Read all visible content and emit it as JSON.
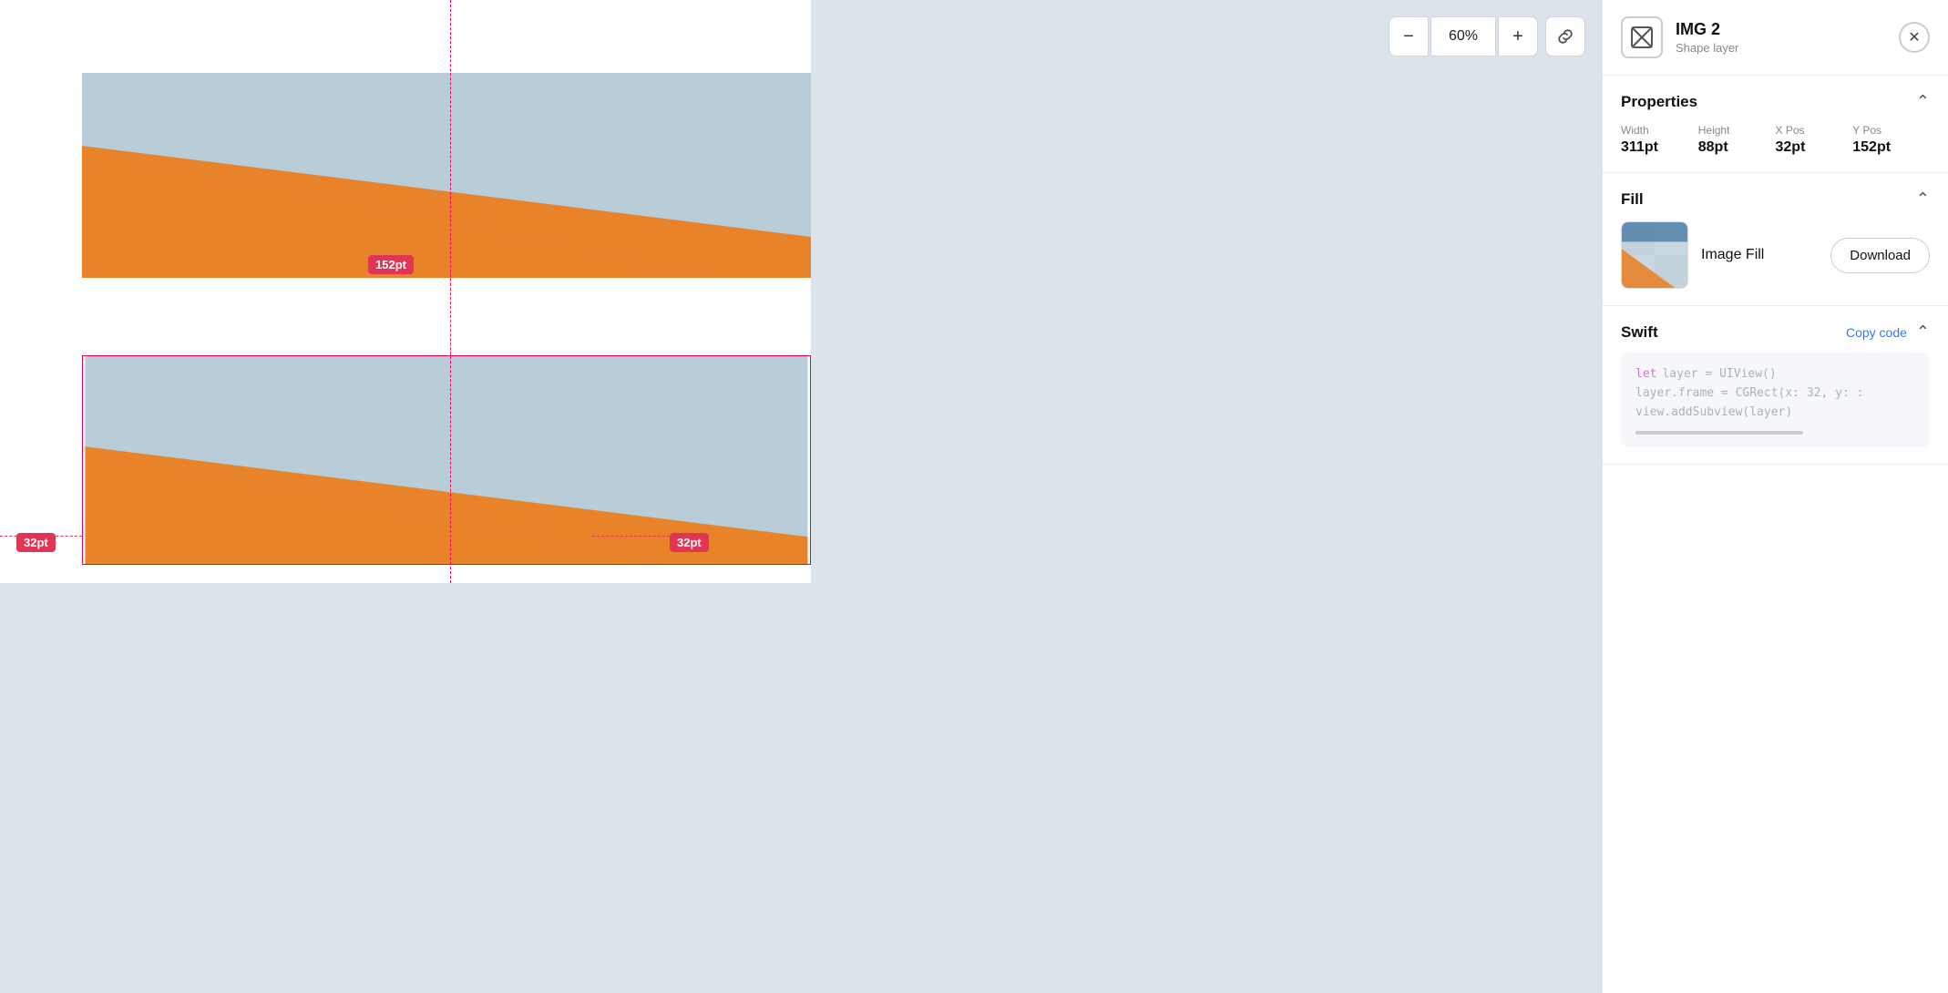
{
  "canvas": {
    "zoom": "60%",
    "background_color": "#dde3ea"
  },
  "zoom_controls": {
    "minus_label": "−",
    "zoom_value": "60%",
    "plus_label": "+",
    "link_icon": "🔗"
  },
  "annotations": {
    "label_152": "152pt",
    "label_32_left": "32pt",
    "label_32_right": "32pt"
  },
  "panel": {
    "title": "IMG 2",
    "subtitle": "Shape layer",
    "close_label": "✕",
    "sections": {
      "properties": {
        "title": "Properties",
        "width_label": "Width",
        "width_value": "311pt",
        "height_label": "Height",
        "height_value": "88pt",
        "xpos_label": "X Pos",
        "xpos_value": "32pt",
        "ypos_label": "Y Pos",
        "ypos_value": "152pt"
      },
      "fill": {
        "title": "Fill",
        "fill_type": "Image Fill",
        "download_label": "Download"
      },
      "swift": {
        "title": "Swift",
        "copy_code_label": "Copy code",
        "code_line1": "let layer = UIView()",
        "code_line2": "layer.frame = CGRect(x: 32, y: :",
        "code_line3": "view.addSubview(layer)"
      }
    }
  }
}
